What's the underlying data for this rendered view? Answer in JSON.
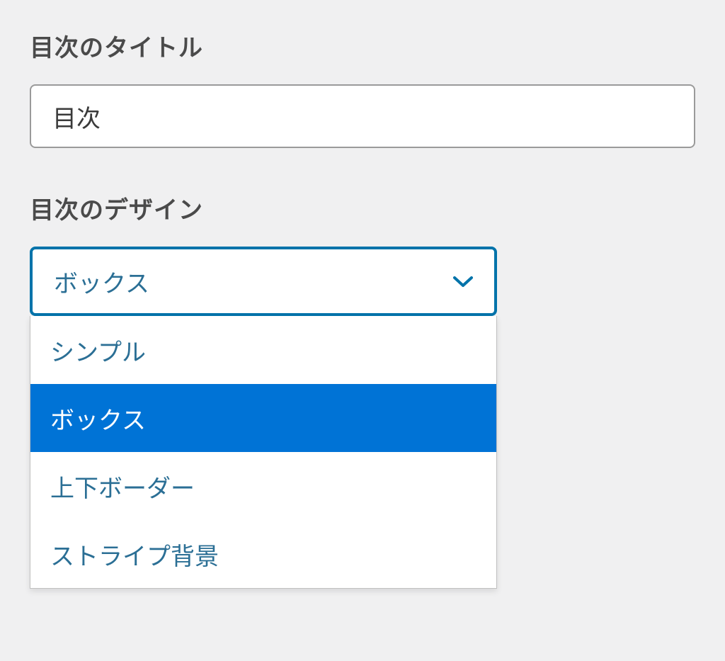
{
  "fields": {
    "title": {
      "label": "目次のタイトル",
      "value": "目次"
    },
    "design": {
      "label": "目次のデザイン",
      "selected": "ボックス",
      "options": [
        {
          "label": "シンプル",
          "selected": false
        },
        {
          "label": "ボックス",
          "selected": true
        },
        {
          "label": "上下ボーダー",
          "selected": false
        },
        {
          "label": "ストライプ背景",
          "selected": false
        }
      ]
    }
  }
}
